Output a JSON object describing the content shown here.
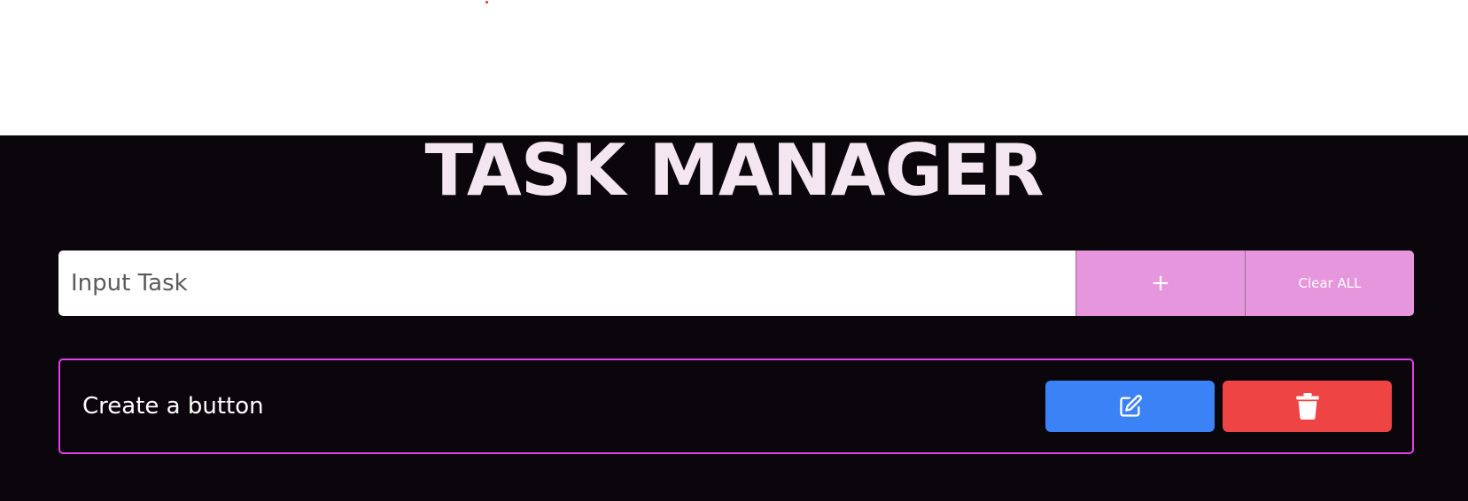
{
  "app": {
    "title": "TASK MANAGER"
  },
  "input": {
    "placeholder": "Input Task",
    "value": ""
  },
  "buttons": {
    "add_label": "+",
    "clear_label": "Clear ALL"
  },
  "tasks": [
    {
      "text": "Create a button"
    }
  ],
  "icons": {
    "edit": "edit-icon",
    "delete": "trash-icon"
  },
  "colors": {
    "background": "#0b050c",
    "title": "#f3e6f1",
    "accent_button": "#e596dc",
    "card_border": "#e040e8",
    "edit_button": "#3b82f6",
    "delete_button": "#ef4444",
    "red_dot": "#e53935"
  }
}
